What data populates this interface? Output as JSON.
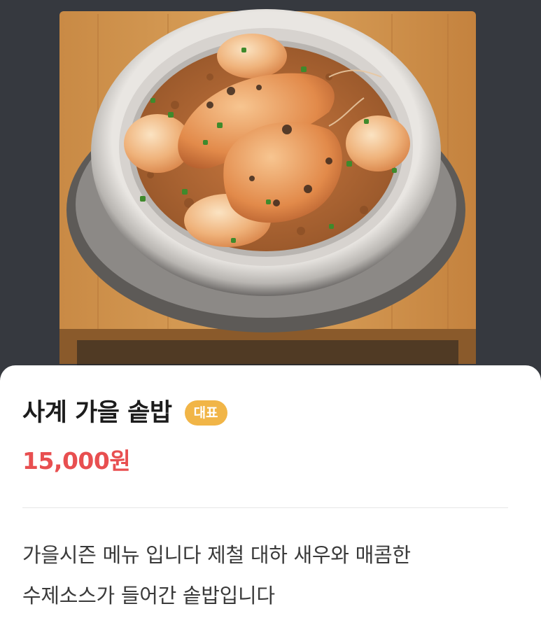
{
  "menu_item": {
    "photo_name": "사계 가을 솥밥",
    "name": "사계 가을 솥밥",
    "badge": "대표",
    "price": "15,000원",
    "description_lines": [
      "가을시즌 메뉴 입니다 제철 대하 새우와 매콤한",
      "수제소스가 들어간 솥밥입니다"
    ]
  },
  "colors": {
    "badge_bg": "#f1b547",
    "price": "#e84f50",
    "title": "#1c1c1c",
    "description": "#3a3a3a",
    "divider": "#e6e6e6"
  }
}
